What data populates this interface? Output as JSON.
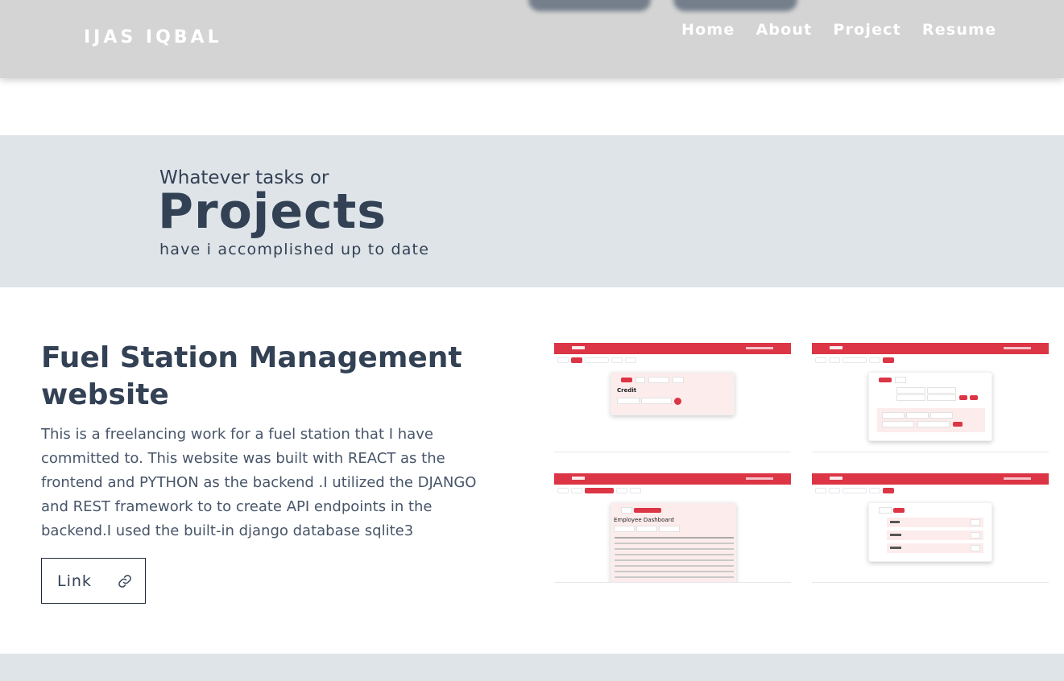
{
  "header": {
    "brand": "IJAS IQBAL",
    "nav": [
      "Home",
      "About",
      "Project",
      "Resume"
    ]
  },
  "hero": {
    "kicker": "Whatever tasks or",
    "title": "Projects",
    "subtitle": "have i accomplished up to date"
  },
  "project": {
    "title": "Fuel Station Management website",
    "description": "This is a freelancing work for a fuel station that I have committed to. This website was built with REACT as the frontend and PYTHON as the backend .I utilized the DJANGO and REST framework to to create API endpoints in the backend.I used the built-in django database sqlite3",
    "link_label": "Link",
    "screenshots": [
      {
        "heading": "Credit"
      },
      {
        "heading": ""
      },
      {
        "heading": "Employee Dashboard"
      },
      {
        "heading": ""
      }
    ]
  },
  "colors": {
    "header_bg": "#d4d4d4",
    "hero_bg": "#dfe4e8",
    "text_dark": "#334155",
    "accent_red": "#dc3545"
  }
}
